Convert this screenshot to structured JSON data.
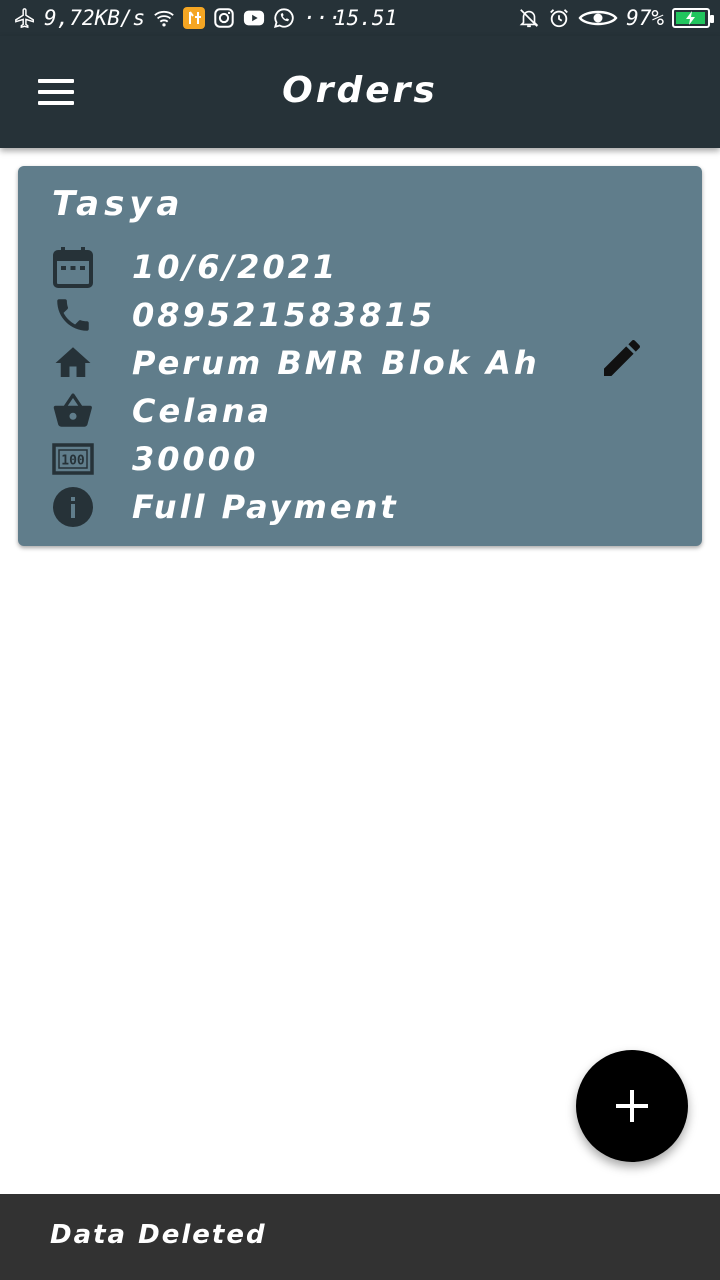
{
  "status_bar": {
    "network_speed": "9,72KB/s",
    "time": "15.51",
    "battery_percent": "97%",
    "battery_level": 0.97,
    "overflow_indicator": "···",
    "left_icons": [
      "airplane-icon",
      "wifi-icon",
      "app-badge-icon",
      "instagram-icon",
      "youtube-icon",
      "whatsapp-icon"
    ],
    "right_icons": [
      "silent-bell-icon",
      "alarm-icon",
      "eye-icon",
      "battery-icon"
    ]
  },
  "app_bar": {
    "title": "Orders",
    "menu_icon": "hamburger-menu-icon"
  },
  "order": {
    "name": "Tasya",
    "date": "10/6/2021",
    "phone": "089521583815",
    "address": "Perum BMR Blok Ah",
    "item": "Celana",
    "price": "30000",
    "payment_status": "Full Payment",
    "icons": {
      "date": "calendar-icon",
      "phone": "phone-icon",
      "address": "home-icon",
      "item": "basket-icon",
      "price": "counter-100-icon",
      "payment_status": "info-icon",
      "edit": "edit-pencil-icon"
    }
  },
  "fab": {
    "icon": "plus-icon"
  },
  "snackbar": {
    "message": "Data Deleted"
  },
  "colors": {
    "app_bar": "#263238",
    "card": "#607d8b",
    "fab": "#000000",
    "snackbar": "#323232",
    "battery_fill": "#22c55e"
  }
}
